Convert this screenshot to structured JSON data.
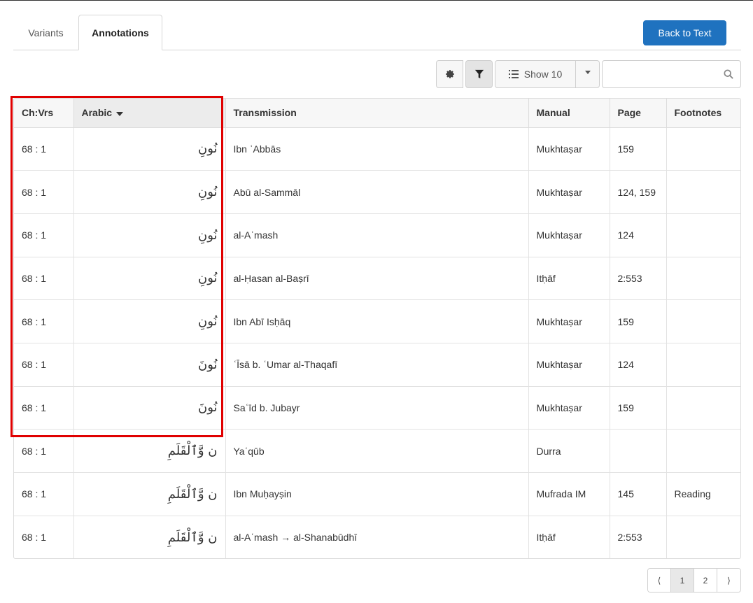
{
  "tabs": [
    {
      "label": "Variants"
    },
    {
      "label": "Annotations"
    }
  ],
  "back_button": "Back to Text",
  "toolbar": {
    "show_label": "Show 10",
    "search_placeholder": ""
  },
  "table": {
    "headers": [
      "Ch:Vrs",
      "Arabic",
      "Transmission",
      "Manual",
      "Page",
      "Footnotes"
    ],
    "sorted_column": "Arabic",
    "rows": [
      {
        "chvrs": "68 : 1",
        "arabic": "نُونِ",
        "transmission": "Ibn ʿAbbās",
        "manual": "Mukhtaṣar",
        "page": "159",
        "footnotes": ""
      },
      {
        "chvrs": "68 : 1",
        "arabic": "نُونِ",
        "transmission": "Abū al-Sammāl",
        "manual": "Mukhtaṣar",
        "page": "124, 159",
        "footnotes": ""
      },
      {
        "chvrs": "68 : 1",
        "arabic": "نُونِ",
        "transmission": "al-Aʿmash",
        "manual": "Mukhtaṣar",
        "page": "124",
        "footnotes": ""
      },
      {
        "chvrs": "68 : 1",
        "arabic": "نُونِ",
        "transmission": "al-Ḥasan al-Baṣrī",
        "manual": "Itḥāf",
        "page": "2:553",
        "footnotes": ""
      },
      {
        "chvrs": "68 : 1",
        "arabic": "نُونِ",
        "transmission": "Ibn Abī Isḥāq",
        "manual": "Mukhtaṣar",
        "page": "159",
        "footnotes": ""
      },
      {
        "chvrs": "68 : 1",
        "arabic": "نُونَ",
        "transmission": "ʿĪsā b. ʿUmar al-Thaqafī",
        "manual": "Mukhtaṣar",
        "page": "124",
        "footnotes": ""
      },
      {
        "chvrs": "68 : 1",
        "arabic": "نُونَ",
        "transmission": "Saʿīd b. Jubayr",
        "manual": "Mukhtaṣar",
        "page": "159",
        "footnotes": ""
      },
      {
        "chvrs": "68 : 1",
        "arabic": "ن وَّٱلْقَلَمِ",
        "transmission": "Yaʿqūb",
        "manual": "Durra",
        "page": "",
        "footnotes": ""
      },
      {
        "chvrs": "68 : 1",
        "arabic": "ن وَّٱلْقَلَمِ",
        "transmission": "Ibn Muḥayṣin",
        "manual": "Mufrada IM",
        "page": "145",
        "footnotes": "Reading"
      },
      {
        "chvrs": "68 : 1",
        "arabic": "ن وَّٱلْقَلَمِ",
        "transmission": "al-Aʿmash → al-Shanabūdhī",
        "manual": "Itḥāf",
        "page": "2:553",
        "footnotes": ""
      }
    ]
  },
  "pagination": {
    "prev": "⟨",
    "pages": [
      "1",
      "2"
    ],
    "active": "1",
    "next": "⟩"
  },
  "colors": {
    "primary": "#1f72bf",
    "highlight": "#e00000"
  }
}
